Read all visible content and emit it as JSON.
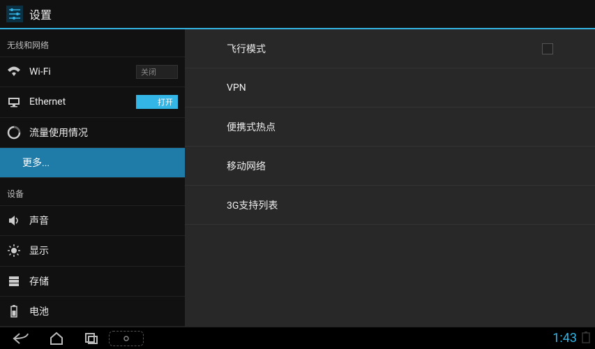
{
  "header": {
    "title": "设置"
  },
  "sidebar": {
    "cat_wireless": "无线和网络",
    "cat_device": "设备",
    "wifi": {
      "label": "Wi-Fi",
      "toggle": "关闭"
    },
    "ethernet": {
      "label": "Ethernet",
      "toggle": "打开"
    },
    "data_usage": {
      "label": "流量使用情况"
    },
    "more": {
      "label": "更多..."
    },
    "sound": {
      "label": "声音"
    },
    "display": {
      "label": "显示"
    },
    "storage": {
      "label": "存储"
    },
    "battery": {
      "label": "电池"
    }
  },
  "content": {
    "airplane": "飞行模式",
    "vpn": "VPN",
    "hotspot": "便携式热点",
    "mobile": "移动网络",
    "three_g": "3G支持列表"
  },
  "status": {
    "clock": "1:43"
  }
}
